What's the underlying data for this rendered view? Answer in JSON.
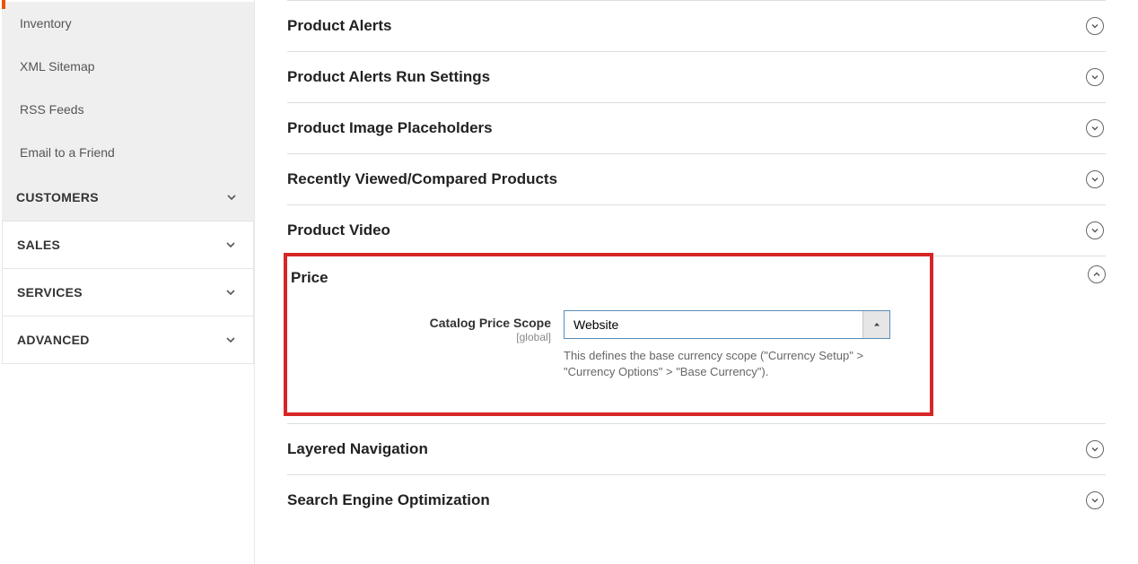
{
  "sidebar": {
    "catalog_items": [
      "Inventory",
      "XML Sitemap",
      "RSS Feeds",
      "Email to a Friend"
    ],
    "groups": [
      {
        "label": "CUSTOMERS"
      },
      {
        "label": "SALES"
      },
      {
        "label": "SERVICES"
      },
      {
        "label": "ADVANCED"
      }
    ]
  },
  "sections": {
    "product_alerts": "Product Alerts",
    "product_alerts_run": "Product Alerts Run Settings",
    "product_image_placeholders": "Product Image Placeholders",
    "recently_viewed": "Recently Viewed/Compared Products",
    "product_video": "Product Video",
    "price": "Price",
    "layered_nav": "Layered Navigation",
    "seo": "Search Engine Optimization"
  },
  "price_form": {
    "label": "Catalog Price Scope",
    "scope": "[global]",
    "value": "Website",
    "help": "This defines the base currency scope (\"Currency Setup\" > \"Currency Options\" > \"Base Currency\")."
  }
}
